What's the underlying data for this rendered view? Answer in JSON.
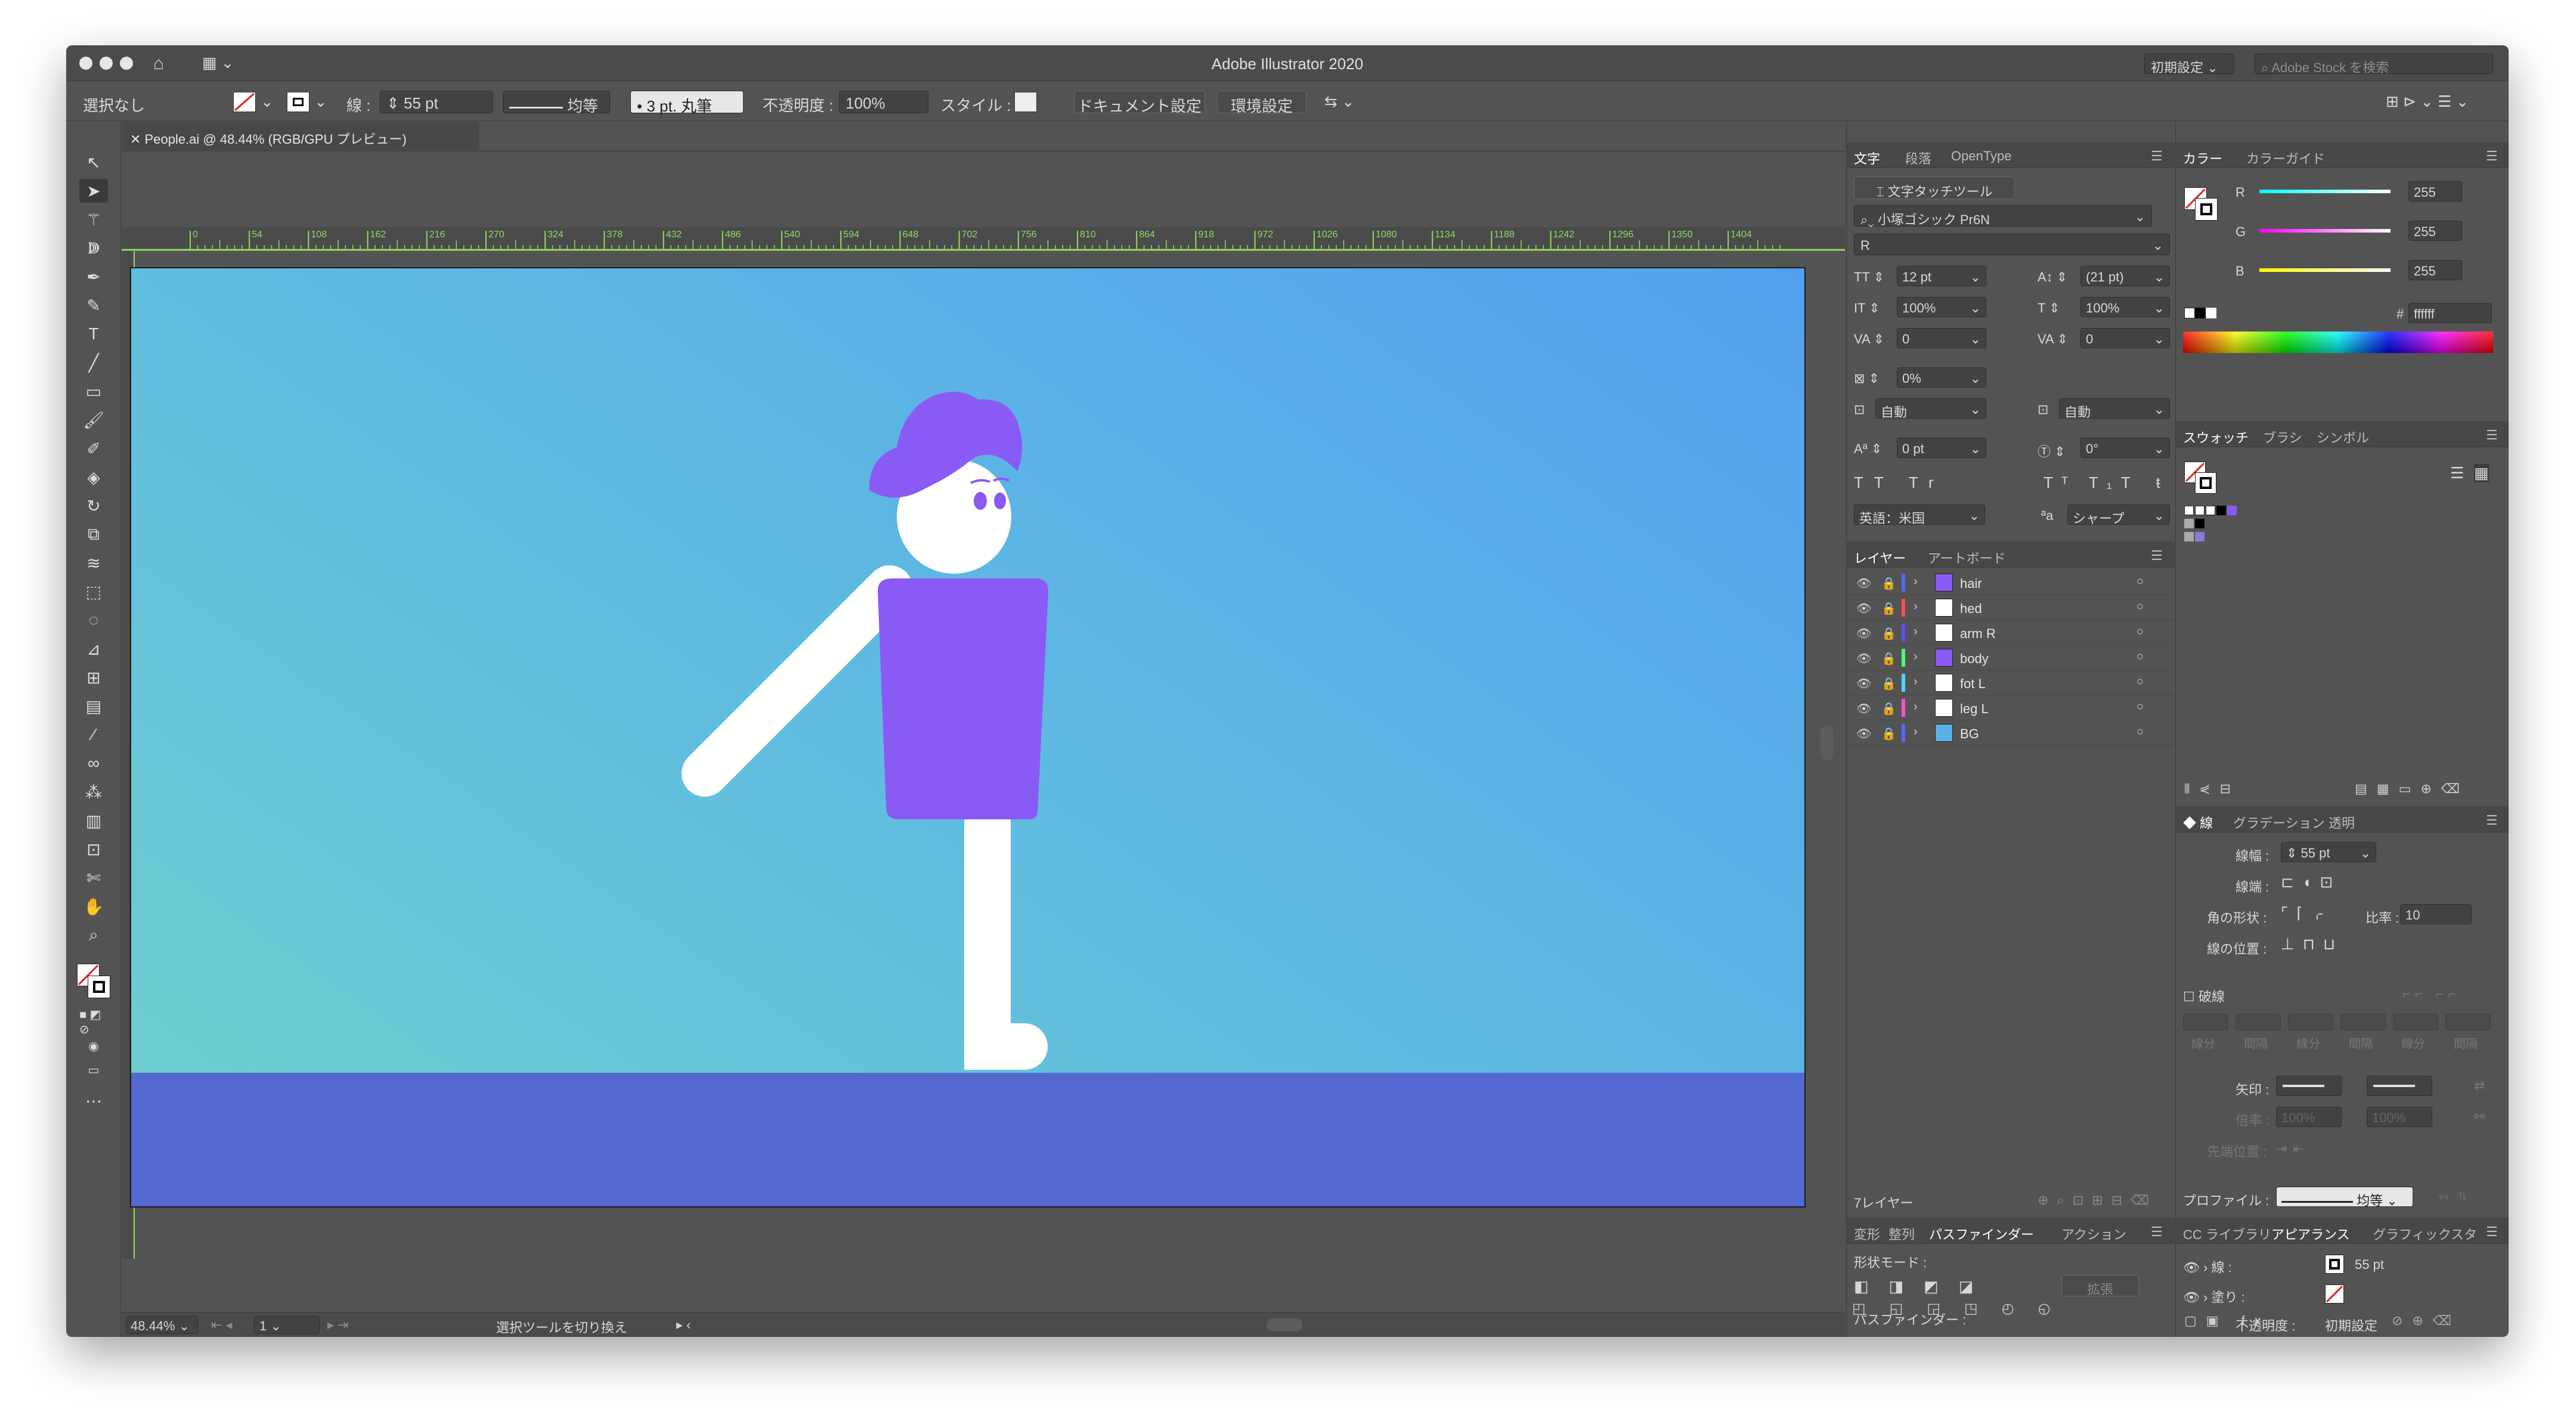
{
  "window": {
    "title": "Adobe Illustrator 2020",
    "workspace": "初期設定",
    "stock_search_placeholder": "Adobe Stock を検索"
  },
  "control_bar": {
    "selection": "選択なし",
    "stroke_label": "線 :",
    "stroke_value": "55 pt",
    "profile_label": "均等",
    "brush_label": "3 pt. 丸筆",
    "opacity_label": "不透明度 :",
    "opacity_value": "100%",
    "style_label": "スタイル :",
    "doc_settings": "ドキュメント設定",
    "prefs": "環境設定"
  },
  "document_tab": {
    "title": "People.ai @ 48.44% (RGB/GPU プレビュー)"
  },
  "ruler_ticks": [
    "0",
    "54",
    "108",
    "162",
    "216",
    "270",
    "324",
    "378",
    "432",
    "486",
    "540",
    "594",
    "648",
    "702",
    "756",
    "810",
    "864",
    "918",
    "972",
    "1026",
    "1080",
    "1134",
    "1188",
    "1242",
    "1296",
    "1350",
    "1404"
  ],
  "status": {
    "zoom": "48.44%",
    "artboard_num": "1",
    "tool_hint": "選択ツールを切り換え"
  },
  "type_panel": {
    "tabs": [
      "文字",
      "段落",
      "OpenType"
    ],
    "touch_tool": "文字タッチツール",
    "font_family": "小塚ゴシック Pr6N",
    "font_style": "R",
    "size": "12 pt",
    "leading": "(21 pt)",
    "vscale": "100%",
    "hscale": "100%",
    "kerning": "0",
    "tracking": "0",
    "tsume": "0%",
    "aki_left": "自動",
    "aki_right": "自動",
    "baseline": "0 pt",
    "rotation": "0°",
    "language": "英語：米国",
    "antialias": "シャープ",
    "aa_icon": "ªa"
  },
  "layers_panel": {
    "tabs": [
      "レイヤー",
      "アートボード"
    ],
    "layers": [
      {
        "name": "hair",
        "color": "#4f6bff",
        "thumb": "#8a5af5"
      },
      {
        "name": "hed",
        "color": "#ff4f4f",
        "thumb": "#ffffff"
      },
      {
        "name": "arm R",
        "color": "#5a4fff",
        "thumb": "#ffffff"
      },
      {
        "name": "body",
        "color": "#4fff6b",
        "thumb": "#8a5af5"
      },
      {
        "name": "fot L",
        "color": "#4fd5ff",
        "thumb": "#ffffff"
      },
      {
        "name": "leg L",
        "color": "#ff4fd5",
        "thumb": "#ffffff"
      },
      {
        "name": "BG",
        "color": "#4f6bff",
        "thumb": "#5ab0e6"
      }
    ],
    "count_label": "7レイヤー"
  },
  "pathfinder_panel": {
    "tabs": [
      "変形",
      "整列",
      "パスファインダー",
      "アクション"
    ],
    "shape_modes": "形状モード :",
    "expand": "拡張",
    "pathfinders": "パスファインダー :"
  },
  "color_panel": {
    "tabs": [
      "カラー",
      "カラーガイド"
    ],
    "r_label": "R",
    "g_label": "G",
    "b_label": "B",
    "r": "255",
    "g": "255",
    "b": "255",
    "hex_label": "#",
    "hex": "ffffff"
  },
  "swatches_panel": {
    "tabs": [
      "スウォッチ",
      "ブラシ",
      "シンボル"
    ],
    "colors": [
      "#ffffff",
      "#000000",
      "#8a5af5",
      "#5468d2"
    ]
  },
  "stroke_panel": {
    "tabs": [
      "線",
      "グラデーション",
      "透明"
    ],
    "weight_label": "線幅 :",
    "weight": "55 pt",
    "cap_label": "線端 :",
    "corner_label": "角の形状 :",
    "limit_label": "比率 :",
    "limit": "10",
    "align_label": "線の位置 :",
    "dashed_label": "破線",
    "dash_fields": [
      "線分",
      "間隔",
      "線分",
      "間隔",
      "線分",
      "間隔"
    ],
    "arrow_label": "矢印 :",
    "scale_label": "倍率 :",
    "scale_a": "100%",
    "scale_b": "100%",
    "tip_label": "先端位置 :",
    "profile_label": "プロファイル :",
    "profile": "均等"
  },
  "appearance_panel": {
    "tabs": [
      "CC ライブラリ",
      "アピアランス",
      "グラフィックスタ"
    ],
    "stroke_label": "線 :",
    "stroke_value": "55 pt",
    "fill_label": "塗り :",
    "opacity_label": "不透明度 :",
    "opacity_value": "初期設定",
    "fx_label": "fx."
  },
  "colors": {
    "character_purple": "#8a5af5",
    "floor": "#5468d2",
    "bg_top": "#54a0ee",
    "bg_bottom": "#6ed1cc"
  }
}
